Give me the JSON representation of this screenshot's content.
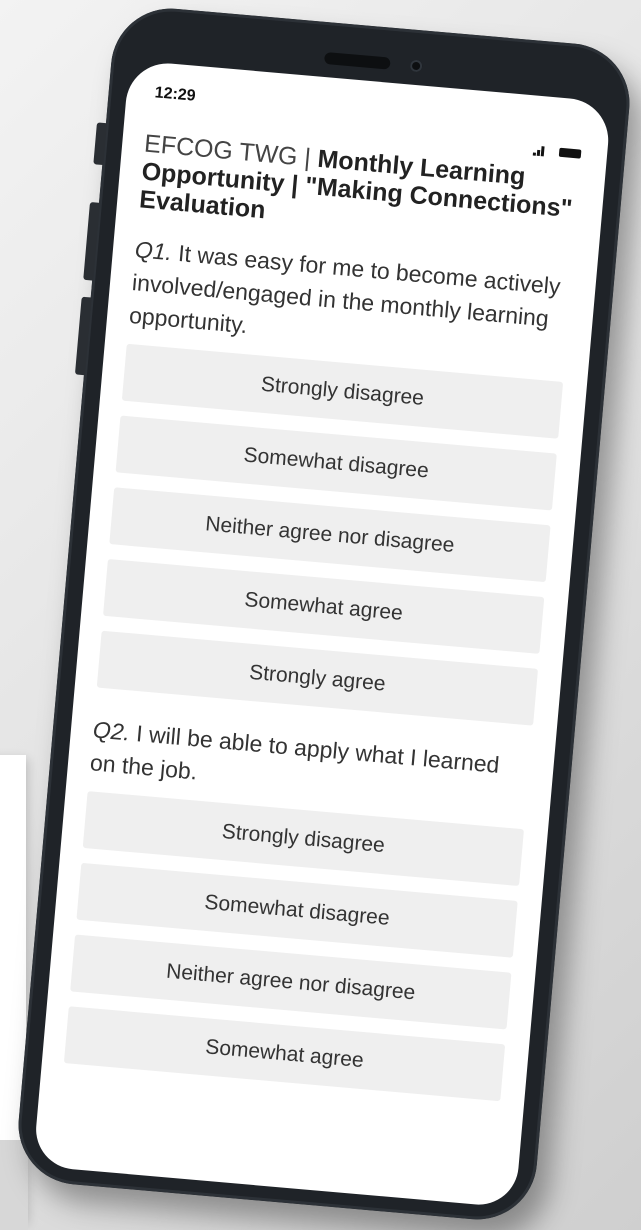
{
  "status_bar": {
    "time": "12:29"
  },
  "survey": {
    "title_prefix": "EFCOG TWG | ",
    "title_main": "Monthly Learning Opportunity | \"Making Connections\" Evaluation",
    "questions": [
      {
        "number": "Q1.",
        "text": " It was easy for me to become actively involved/engaged in the monthly learning opportunity.",
        "options": [
          "Strongly disagree",
          "Somewhat disagree",
          "Neither agree nor disagree",
          "Somewhat agree",
          "Strongly agree"
        ]
      },
      {
        "number": "Q2.",
        "text": " I will be able to apply what I learned on the job.",
        "options": [
          "Strongly disagree",
          "Somewhat disagree",
          "Neither agree nor disagree",
          "Somewhat agree"
        ]
      }
    ]
  },
  "icons": {
    "signal": "signal-icon",
    "battery": "battery-icon"
  },
  "colors": {
    "phone_frame": "#1f2328",
    "option_background": "#efefef",
    "text": "#333333"
  }
}
